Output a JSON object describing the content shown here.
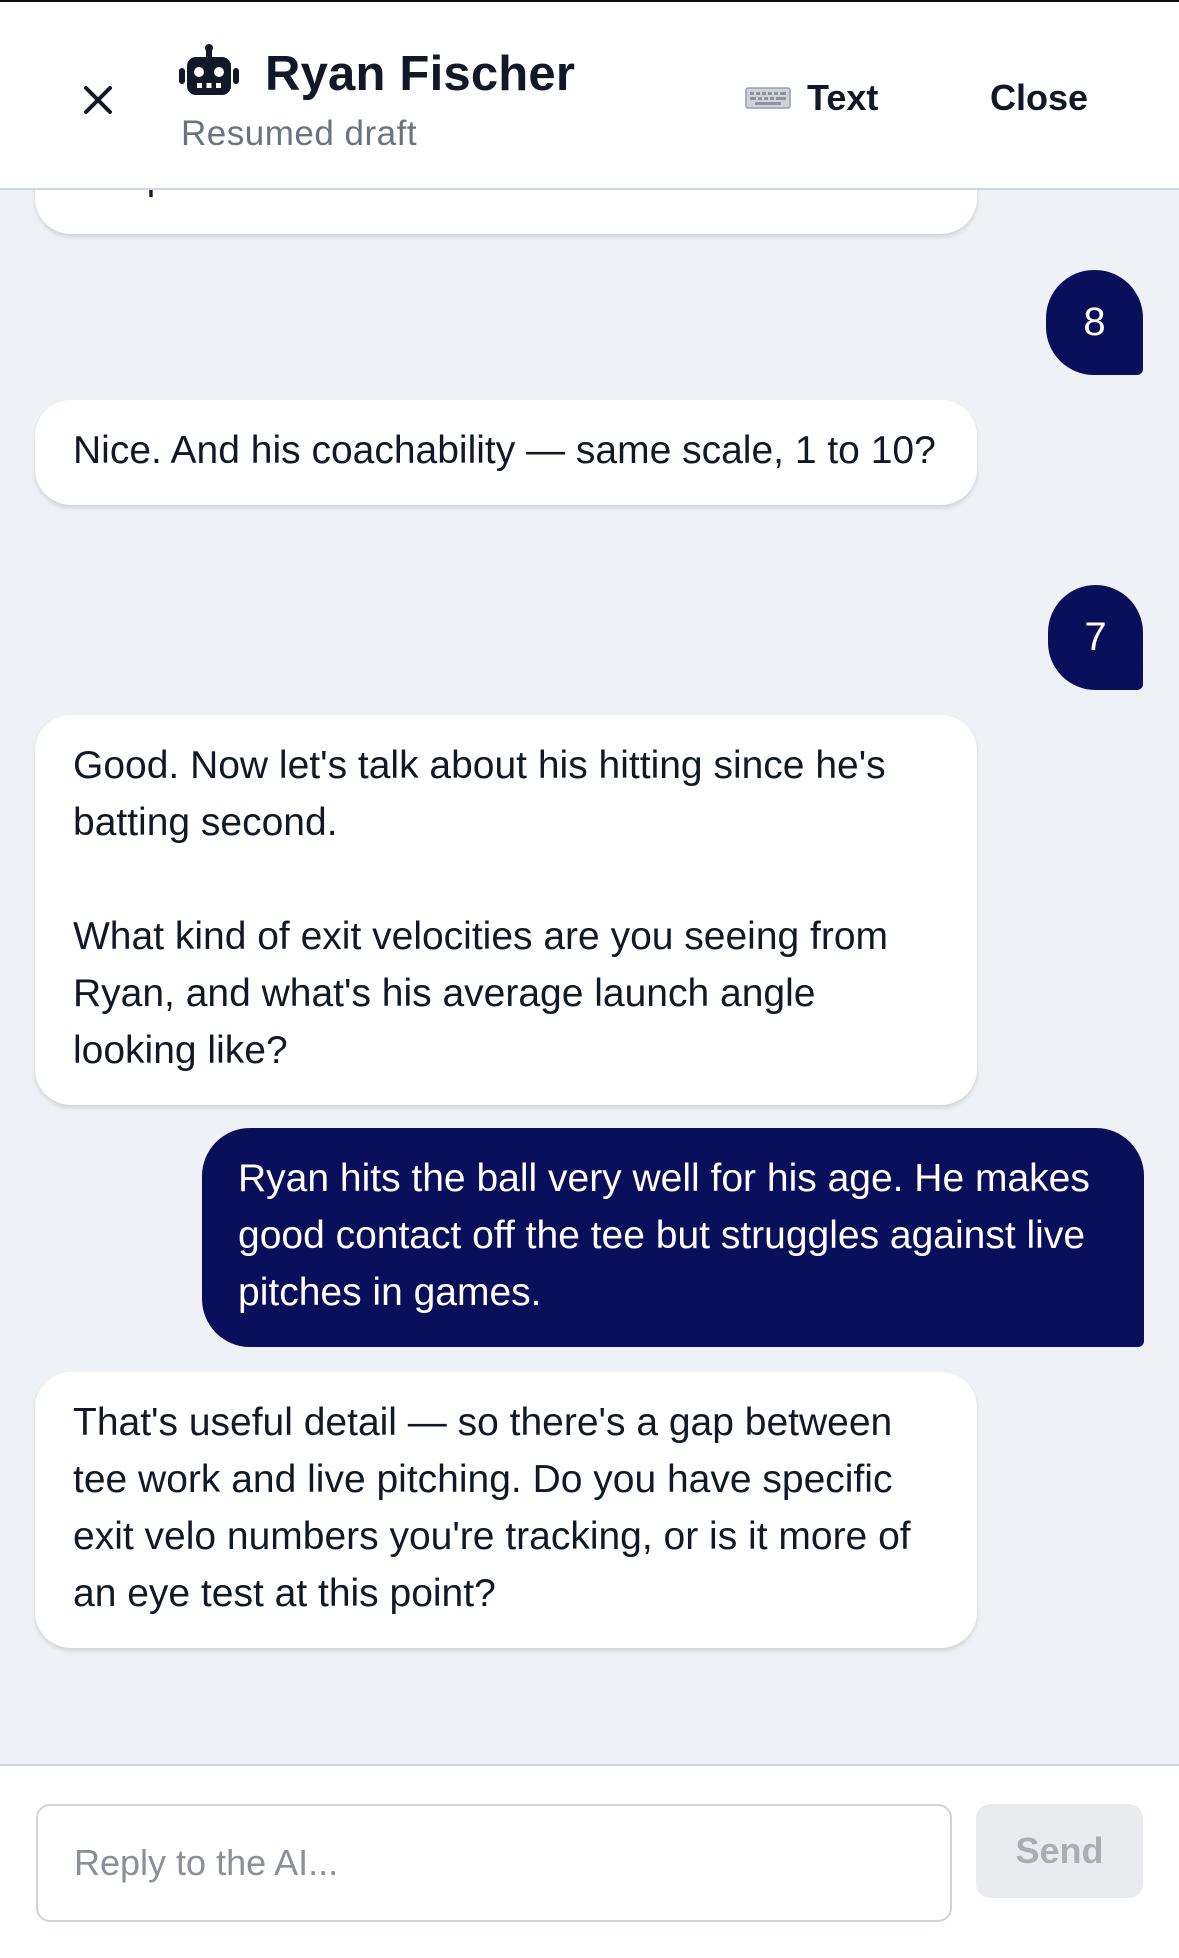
{
  "header": {
    "title": "Ryan Fischer",
    "subtitle": "Resumed draft",
    "mode_label": "Text",
    "close_label": "Close"
  },
  "messages": [
    {
      "role": "ai",
      "text": "competitiveness?"
    },
    {
      "role": "user",
      "text": "8"
    },
    {
      "role": "ai",
      "text": "Nice. And his coachability — same scale, 1 to 10?"
    },
    {
      "role": "user",
      "text": "7"
    },
    {
      "role": "ai",
      "text": "Good. Now let's talk about his hitting since he's batting second.\n\nWhat kind of exit velocities are you seeing from Ryan, and what's his average launch angle looking like?"
    },
    {
      "role": "user",
      "text": "Ryan hits the ball very well for his age. He makes good contact off the tee but struggles against live pitches in games."
    },
    {
      "role": "ai",
      "text": "That's useful detail — so there's a gap between tee work and live pitching. Do you have specific exit velo numbers you're tracking, or is it more of an eye test at this point?"
    }
  ],
  "composer": {
    "placeholder": "Reply to the AI...",
    "send_label": "Send"
  },
  "colors": {
    "user_bubble": "#0a0f5c",
    "ai_bubble": "#ffffff",
    "background": "#eef1f6"
  }
}
